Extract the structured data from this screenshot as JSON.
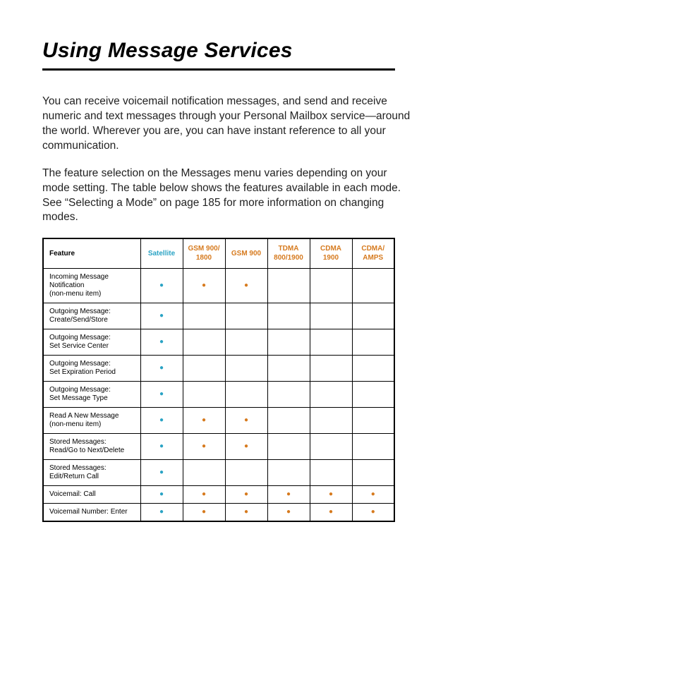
{
  "title": "Using Message Services",
  "para1": "You can receive voicemail notification messages, and send and receive numeric and text messages through your Personal Mailbox service—around the world. Wherever you are, you can have instant reference to all your communication.",
  "para2": "The feature selection on the Messages menu varies depending on your mode setting. The table below shows the features available in each mode. See “Selecting a Mode” on page 185 for more information on changing modes.",
  "headers": {
    "feature": "Feature",
    "satellite": "Satellite",
    "gsm900_1800": "GSM 900/ 1800",
    "gsm900": "GSM 900",
    "tdma": "TDMA 800/1900",
    "cdma1900": "CDMA 1900",
    "cdma_amps": "CDMA/ AMPS"
  },
  "rows": [
    {
      "label": "Incoming Message Notification\n(non-menu item)",
      "dots": [
        "sat",
        "or",
        "or",
        "",
        "",
        ""
      ]
    },
    {
      "label": "Outgoing Message:\nCreate/Send/Store",
      "dots": [
        "sat",
        "",
        "",
        "",
        "",
        ""
      ]
    },
    {
      "label": "Outgoing Message:\nSet Service Center",
      "dots": [
        "sat",
        "",
        "",
        "",
        "",
        ""
      ]
    },
    {
      "label": "Outgoing Message:\nSet Expiration Period",
      "dots": [
        "sat",
        "",
        "",
        "",
        "",
        ""
      ]
    },
    {
      "label": "Outgoing Message:\nSet Message Type",
      "dots": [
        "sat",
        "",
        "",
        "",
        "",
        ""
      ]
    },
    {
      "label": "Read A New Message\n(non-menu item)",
      "dots": [
        "sat",
        "or",
        "or",
        "",
        "",
        ""
      ]
    },
    {
      "label": "Stored Messages:\nRead/Go to Next/Delete",
      "dots": [
        "sat",
        "or",
        "or",
        "",
        "",
        ""
      ]
    },
    {
      "label": "Stored Messages:\nEdit/Return Call",
      "dots": [
        "sat",
        "",
        "",
        "",
        "",
        ""
      ]
    },
    {
      "label": "Voicemail: Call",
      "dots": [
        "sat",
        "or",
        "or",
        "or",
        "or",
        "or"
      ]
    },
    {
      "label": "Voicemail Number: Enter",
      "dots": [
        "sat",
        "or",
        "or",
        "or",
        "or",
        "or"
      ]
    }
  ]
}
